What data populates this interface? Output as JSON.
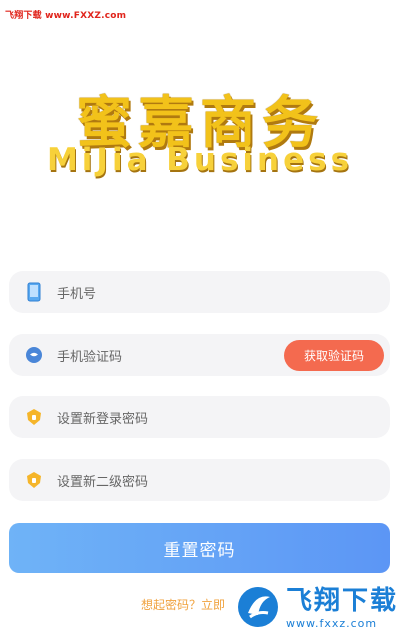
{
  "watermark_top": "飞翔下载 www.FXXZ.com",
  "logo": {
    "cn": "蜜嘉商务",
    "en": "MiJia Business"
  },
  "fields": {
    "phone_placeholder": "手机号",
    "code_placeholder": "手机验证码",
    "get_code_label": "获取验证码",
    "new_login_pwd_placeholder": "设置新登录密码",
    "new_second_pwd_placeholder": "设置新二级密码"
  },
  "submit_label": "重置密码",
  "remember_text": "想起密码？立即",
  "watermark_badge": {
    "name": "飞翔下载",
    "url": "www.fxxz.com"
  },
  "colors": {
    "accent_red": "#f46a4f",
    "submit_gradient_start": "#6fb3f7",
    "submit_gradient_end": "#5c96f5",
    "logo_gold": "#f2c21a",
    "link_orange": "#f0a23d"
  },
  "icons": {
    "phone": "phone-icon",
    "code": "message-icon",
    "login_pwd": "lock-shield-icon",
    "second_pwd": "lock-shield-icon"
  }
}
